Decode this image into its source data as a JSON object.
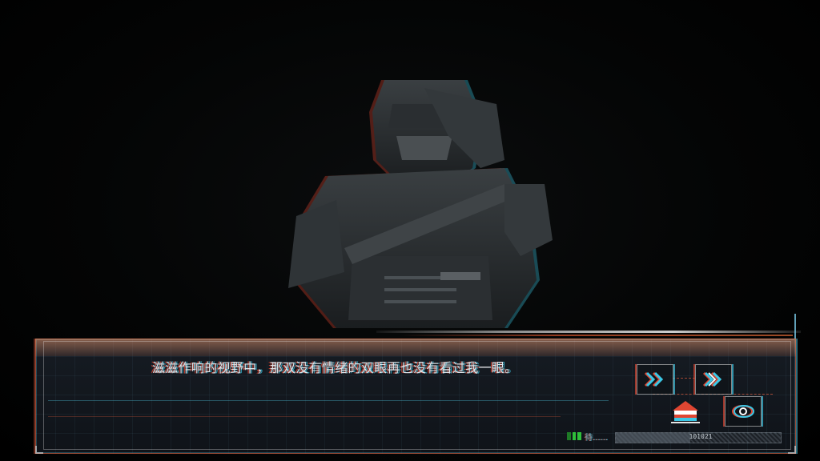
{
  "dialog": {
    "text": "滋滋作响的视野中，那双没有情绪的双眼再也没有看过我一眼。"
  },
  "controls": {
    "skip_icon": "double-chevron-right-icon",
    "auto_icon": "double-chevron-right-icon",
    "save_icon": "house-icon",
    "view_icon": "eye-icon"
  },
  "status": {
    "label": "待......",
    "code": "101021",
    "progress": 0.45
  },
  "colors": {
    "glitch_red": "#e04632",
    "glitch_cyan": "#3cc8e6",
    "frame_white": "#e6e6e6",
    "status_green": "#2fbf3a"
  }
}
